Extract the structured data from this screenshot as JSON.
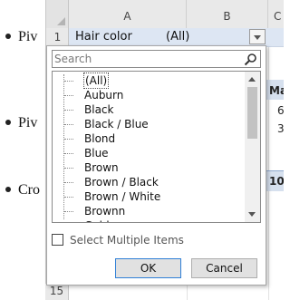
{
  "document": {
    "bullets": [
      "Piv",
      "Piv",
      "Cro"
    ]
  },
  "sheet": {
    "columns": [
      "A",
      "B",
      "C"
    ],
    "row1": {
      "number": "1",
      "field": "Hair color",
      "value": "(All)"
    },
    "bottom_row_number": "15",
    "pivot_fragments": {
      "header": "Ma",
      "values": [
        "6",
        "3"
      ],
      "total": "10"
    }
  },
  "filter_panel": {
    "search_placeholder": "Search",
    "items": [
      "(All)",
      "Auburn",
      "Black",
      "Black / Blue",
      "Blond",
      "Blue",
      "Brown",
      "Brown / Black",
      "Brown / White",
      "Brownn",
      "Gold"
    ],
    "selected_item": "(All)",
    "select_multiple_label": "Select Multiple Items",
    "select_multiple_checked": false,
    "ok_label": "OK",
    "cancel_label": "Cancel",
    "scroll_position": 0
  }
}
